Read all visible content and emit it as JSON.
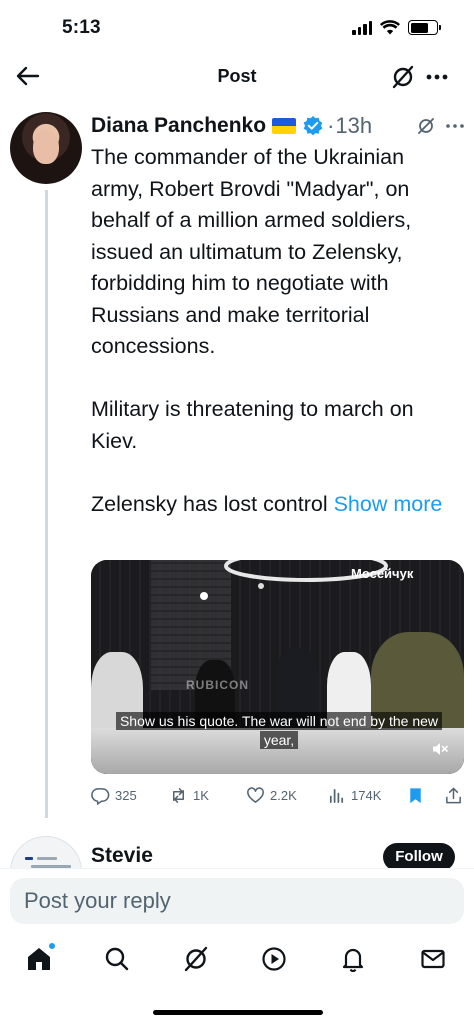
{
  "status_bar": {
    "time": "5:13"
  },
  "nav": {
    "title": "Post",
    "back_icon": "arrow-left-icon",
    "grok_icon": "grok-icon",
    "more_icon": "more-horizontal-icon"
  },
  "tweet": {
    "author_name": "Diana Panchenko",
    "flag": "ukraine-flag",
    "verified": true,
    "separator": "·",
    "time_ago": "13h",
    "paragraphs": [
      "The commander of the Ukrainian army, Robert Brovdi \"Madyar\", on behalf of a million armed soldiers, issued an ultimatum to Zelensky, forbidding him to negotiate with Russians and make territorial concessions.",
      "Military is threatening to march on Kiev.",
      "Zelensky has lost control"
    ],
    "show_more": "Show more",
    "media": {
      "watermark": "Мосейчук",
      "center_logo": "RUBICON",
      "caption": "Show us his quote. The war will not end by the new year,"
    },
    "actions": {
      "replies": "325",
      "reposts": "1K",
      "likes": "2.2K",
      "views": "174K"
    }
  },
  "next_reply": {
    "author_name": "Stevie",
    "follow_label": "Follow"
  },
  "reply_bar": {
    "placeholder": "Post your reply"
  },
  "tab_bar": {
    "items": [
      "home-icon",
      "search-icon",
      "grok-icon",
      "video-icon",
      "notifications-icon",
      "messages-icon"
    ]
  },
  "colors": {
    "accent": "#1d9bf0",
    "text": "#0f1419",
    "secondary": "#536471"
  }
}
